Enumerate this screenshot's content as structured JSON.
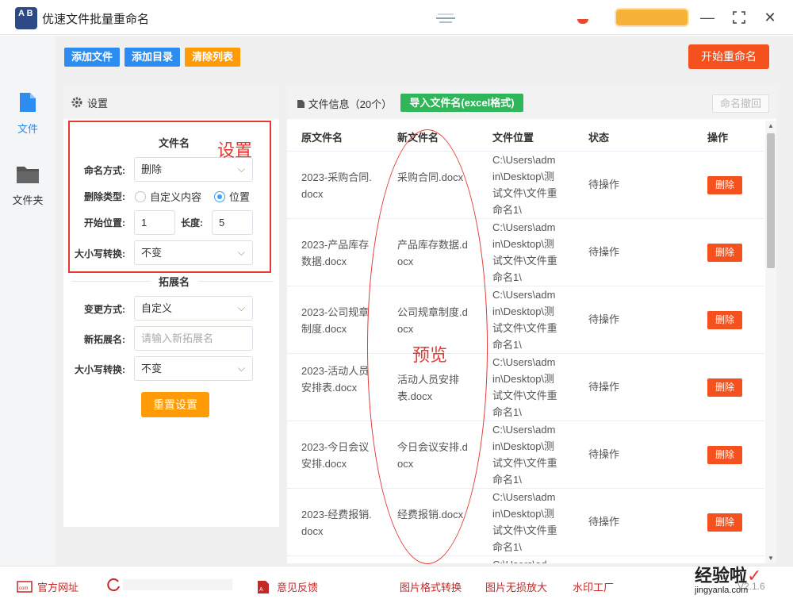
{
  "app": {
    "title": "优速文件批量重命名",
    "logo_text": "A B"
  },
  "titlebar": {
    "min_icon": "minimize-icon",
    "max_icon": "maximize-icon",
    "close_icon": "close-icon"
  },
  "nav": [
    {
      "label": "文件",
      "icon": "file-icon",
      "active": true
    },
    {
      "label": "文件夹",
      "icon": "folder-icon",
      "active": false
    }
  ],
  "toolbar": {
    "add_file": "添加文件",
    "add_dir": "添加目录",
    "clear_list": "清除列表",
    "start": "开始重命名"
  },
  "settings": {
    "header": "设置",
    "filename_section": "文件名",
    "naming_mode_label": "命名方式:",
    "naming_mode_value": "删除",
    "delete_type_label": "删除类型:",
    "delete_type_options": [
      "自定义内容",
      "位置"
    ],
    "delete_type_selected": "位置",
    "start_pos_label": "开始位置:",
    "start_pos_value": "1",
    "length_label": "长度:",
    "length_value": "5",
    "case_label": "大小写转换:",
    "case_value": "不变",
    "ext_section": "拓展名",
    "change_mode_label": "变更方式:",
    "change_mode_value": "自定义",
    "new_ext_label": "新拓展名:",
    "new_ext_placeholder": "请输入新拓展名",
    "ext_case_label": "大小写转换:",
    "ext_case_value": "不变",
    "reset": "重置设置"
  },
  "annotations": {
    "settings": "设置",
    "preview": "预览"
  },
  "files": {
    "title": "文件信息（20个）",
    "import_btn": "导入文件名(excel格式)",
    "undo_btn": "命名撤回",
    "columns": [
      "原文件名",
      "新文件名",
      "文件位置",
      "状态",
      "操作"
    ],
    "rows": [
      {
        "orig": "2023-采购合同.docx",
        "new": "采购合同.docx",
        "loc": "C:\\Users\\admin\\Desktop\\测试文件\\文件重命名1\\",
        "status": "待操作",
        "action": "删除"
      },
      {
        "orig": "2023-产品库存数据.docx",
        "new": "产品库存数据.docx",
        "loc": "C:\\Users\\admin\\Desktop\\测试文件\\文件重命名1\\",
        "status": "待操作",
        "action": "删除"
      },
      {
        "orig": "2023-公司规章制度.docx",
        "new": "公司规章制度.docx",
        "loc": "C:\\Users\\admin\\Desktop\\测试文件\\文件重命名1\\",
        "status": "待操作",
        "action": "删除"
      },
      {
        "orig": "2023-活动人员安排表.docx",
        "new": "活动人员安排表.docx",
        "loc": "C:\\Users\\admin\\Desktop\\测试文件\\文件重命名1\\",
        "status": "待操作",
        "action": "删除"
      },
      {
        "orig": "2023-今日会议安排.docx",
        "new": "今日会议安排.docx",
        "loc": "C:\\Users\\admin\\Desktop\\测试文件\\文件重命名1\\",
        "status": "待操作",
        "action": "删除"
      },
      {
        "orig": "2023-经费报销.docx",
        "new": "经费报销.docx",
        "loc": "C:\\Users\\admin\\Desktop\\测试文件\\文件重命名1\\",
        "status": "待操作",
        "action": "删除"
      },
      {
        "orig": "",
        "new": "",
        "loc": "C:\\Users\\ad",
        "status": "",
        "action": ""
      }
    ]
  },
  "footer": {
    "official_site": "官方网址",
    "feedback": "意见反馈",
    "img_convert": "图片格式转换",
    "img_enlarge": "图片无损放大",
    "watermark": "水印工厂",
    "version": "V2.1.6"
  },
  "watermark_brand": {
    "text": "经验啦",
    "sub": "jingyanla.com"
  },
  "colors": {
    "primary": "#2d8cf0",
    "orange": "#ff9b06",
    "red": "#f4511e",
    "green": "#2fb65a"
  }
}
